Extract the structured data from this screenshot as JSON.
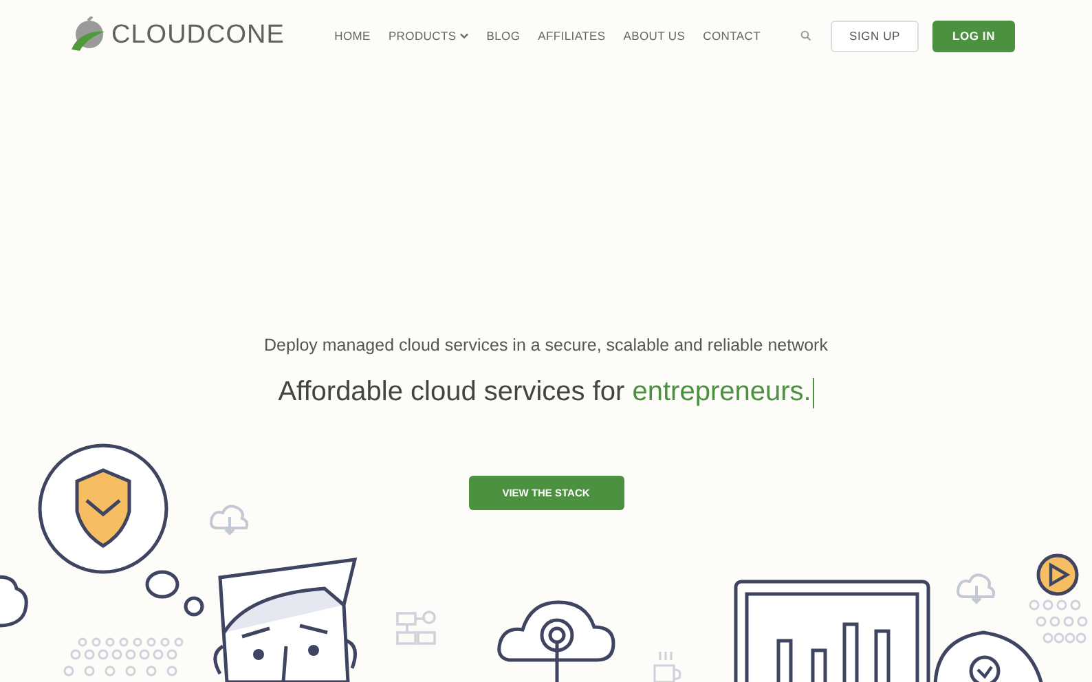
{
  "logo": {
    "text": "CLOUDCONE"
  },
  "nav": [
    {
      "label": "HOME",
      "has_menu": false
    },
    {
      "label": "PRODUCTS",
      "has_menu": true
    },
    {
      "label": "BLOG",
      "has_menu": false
    },
    {
      "label": "AFFILIATES",
      "has_menu": false
    },
    {
      "label": "ABOUT US",
      "has_menu": false
    },
    {
      "label": "CONTACT",
      "has_menu": false
    }
  ],
  "actions": [
    {
      "label": "SIGN UP",
      "kind": "outline"
    },
    {
      "label": "LOG IN",
      "kind": "primary"
    }
  ],
  "hero": {
    "subtitle": "Deploy managed cloud services in a secure, scalable and reliable network",
    "headline": "Affordable cloud services for ",
    "headline_highlight": "entrepreneurs.",
    "cursor": true,
    "button": "VIEW THE STACK"
  }
}
